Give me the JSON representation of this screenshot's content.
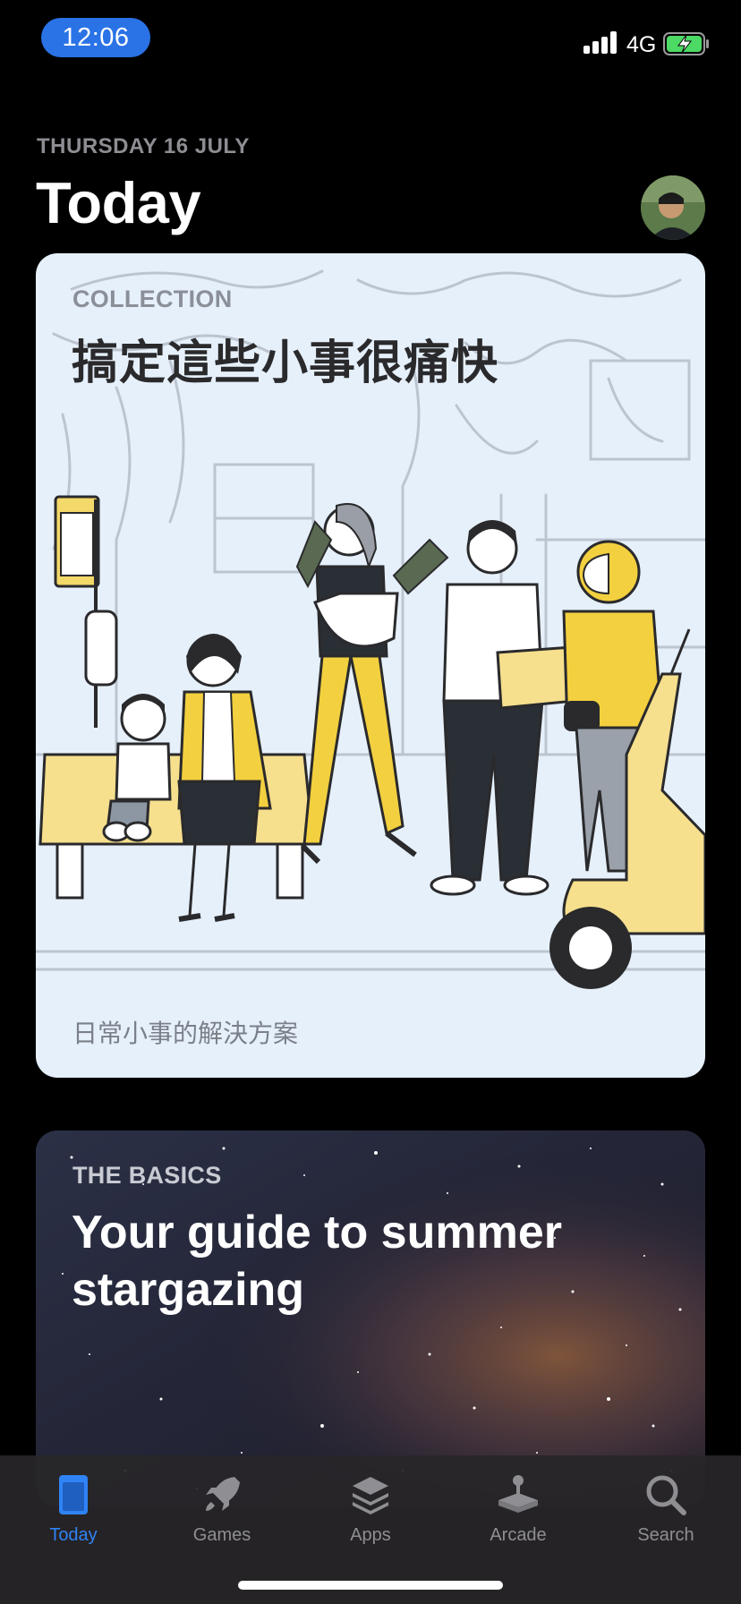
{
  "status_bar": {
    "time": "12:06",
    "network": "4G"
  },
  "header": {
    "date": "THURSDAY 16 JULY",
    "title": "Today"
  },
  "cards": [
    {
      "eyebrow": "COLLECTION",
      "title": "搞定這些小事很痛快",
      "subtitle": "日常小事的解決方案"
    },
    {
      "eyebrow": "THE BASICS",
      "title": "Your guide to summer stargazing"
    }
  ],
  "tab_bar": {
    "tabs": [
      {
        "label": "Today",
        "icon": "today-icon",
        "active": true
      },
      {
        "label": "Games",
        "icon": "rocket-icon",
        "active": false
      },
      {
        "label": "Apps",
        "icon": "layers-icon",
        "active": false
      },
      {
        "label": "Arcade",
        "icon": "joystick-icon",
        "active": false
      },
      {
        "label": "Search",
        "icon": "search-icon",
        "active": false
      }
    ]
  },
  "colors": {
    "accent": "#2F83F5",
    "time_pill": "#2A73E6",
    "battery_charging": "#4CD964",
    "inactive_tab": "#8E8E93"
  }
}
